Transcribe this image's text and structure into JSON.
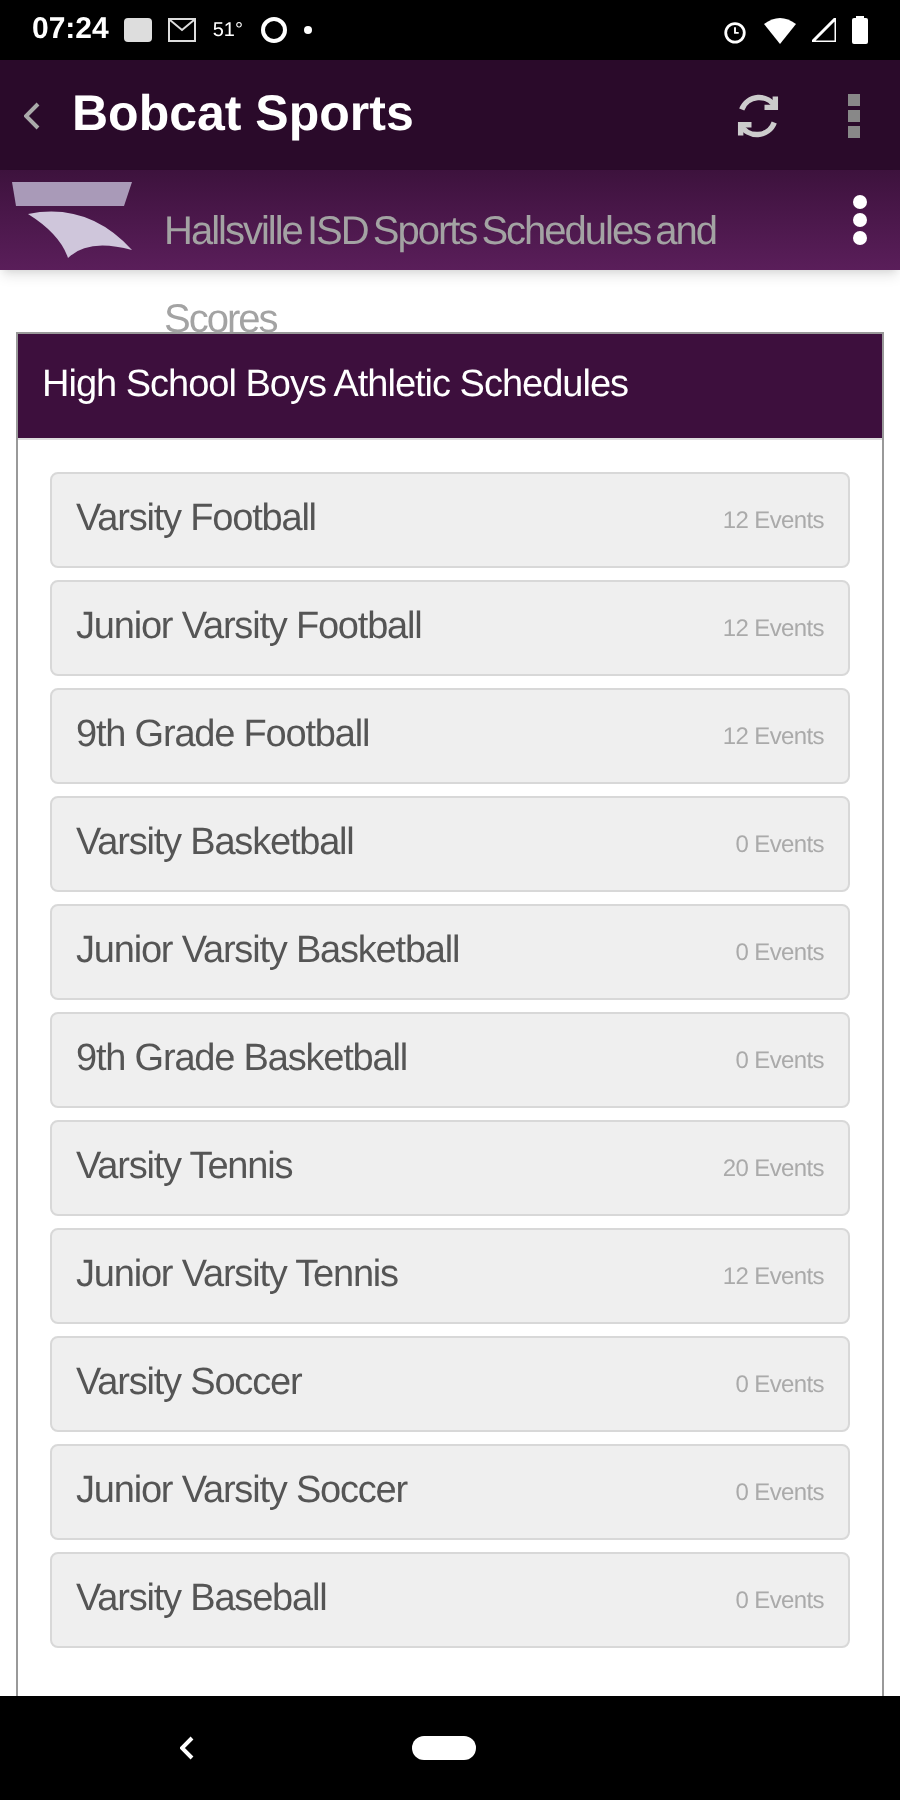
{
  "status_bar": {
    "time": "07:24",
    "temperature": "51°"
  },
  "app_bar": {
    "title": "Bobcat Sports"
  },
  "sub_header": {
    "title": "Hallsville ISD Sports Schedules and Scores"
  },
  "card": {
    "title": "High School Boys Athletic Schedules",
    "items": [
      {
        "name": "Varsity Football",
        "count": "12 Events"
      },
      {
        "name": "Junior Varsity Football",
        "count": "12 Events"
      },
      {
        "name": "9th Grade Football",
        "count": "12 Events"
      },
      {
        "name": "Varsity Basketball",
        "count": "0 Events"
      },
      {
        "name": "Junior Varsity Basketball",
        "count": "0 Events"
      },
      {
        "name": "9th Grade Basketball",
        "count": "0 Events"
      },
      {
        "name": "Varsity Tennis",
        "count": "20 Events"
      },
      {
        "name": "Junior Varsity Tennis",
        "count": "12 Events"
      },
      {
        "name": "Varsity Soccer",
        "count": "0 Events"
      },
      {
        "name": "Junior Varsity Soccer",
        "count": "0 Events"
      },
      {
        "name": "Varsity Baseball",
        "count": "0 Events"
      }
    ]
  }
}
